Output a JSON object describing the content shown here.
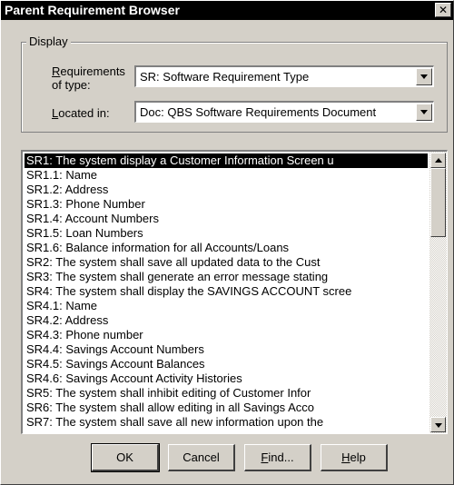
{
  "window": {
    "title": "Parent Requirement Browser",
    "close_glyph": "✕"
  },
  "display_group": {
    "label": "Display",
    "requirements_label_access": "R",
    "requirements_label_rest1": "equirements",
    "requirements_label_line2": "of type:",
    "requirements_value": "SR: Software Requirement Type",
    "located_label_access": "L",
    "located_label_rest": "ocated in:",
    "located_value": "Doc: QBS Software Requirements Document"
  },
  "list": {
    "selected_index": 0,
    "items": [
      "SR1: The system display a Customer Information Screen u",
      "SR1.1: Name",
      "SR1.2: Address",
      "SR1.3: Phone Number",
      "SR1.4: Account Numbers",
      "SR1.5: Loan Numbers",
      "SR1.6: Balance information for all Accounts/Loans",
      "SR2: The system shall save all updated data to the Cust",
      "SR3: The system shall generate an error message stating",
      "SR4: The system shall display the SAVINGS ACCOUNT scree",
      "SR4.1: Name",
      "SR4.2: Address",
      "SR4.3: Phone number",
      "SR4.4: Savings Account Numbers",
      "SR4.5: Savings Account Balances",
      "SR4.6: Savings Account Activity Histories",
      "SR5: The system shall inhibit editing of Customer Infor",
      "SR6: The system shall allow editing in all Savings Acco",
      "SR7: The system shall save all new information upon the"
    ]
  },
  "buttons": {
    "ok": "OK",
    "cancel": "Cancel",
    "find_access": "F",
    "find_rest": "ind...",
    "help_access": "H",
    "help_rest": "elp"
  },
  "icons": {
    "close": "close-icon",
    "combo_arrow": "chevron-down-icon",
    "scroll_up": "arrow-up-icon",
    "scroll_down": "arrow-down-icon"
  }
}
